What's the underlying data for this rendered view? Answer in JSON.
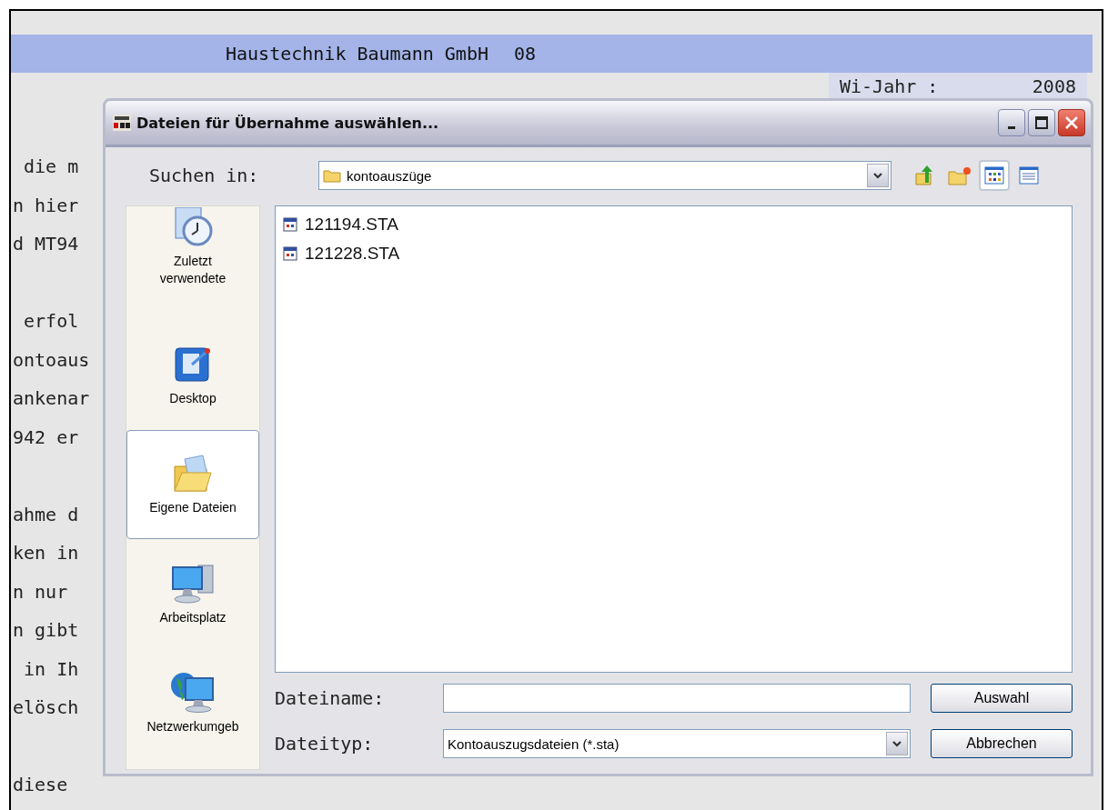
{
  "header": {
    "company": "Haustechnik Baumann GmbH",
    "number": "08",
    "fiscal_year_label": "Wi-Jahr :",
    "fiscal_year": "2008"
  },
  "background_paragraphs": [
    [
      " die m",
      "n hier",
      "d MT94"
    ],
    [
      " erfol",
      "ontoaus",
      "ankenar",
      "942 er"
    ],
    [
      "ahme d",
      "ken in",
      "n nur",
      "n gibt",
      " in Ih",
      "elösch"
    ],
    [
      "diese"
    ]
  ],
  "dialog": {
    "title": "Dateien für Übernahme auswählen...",
    "look_in_label": "Suchen in:",
    "look_in_value": "kontoauszüge",
    "toolbar": [
      {
        "kind": "up",
        "selected": false
      },
      {
        "kind": "newfolder",
        "selected": false
      },
      {
        "kind": "list",
        "selected": true
      },
      {
        "kind": "details",
        "selected": false
      }
    ],
    "places": [
      {
        "kind": "recent",
        "label": "Zuletzt verwendete",
        "selected": false
      },
      {
        "kind": "desktop",
        "label": "Desktop",
        "selected": false
      },
      {
        "kind": "documents",
        "label": "Eigene Dateien",
        "selected": true
      },
      {
        "kind": "computer",
        "label": "Arbeitsplatz",
        "selected": false
      },
      {
        "kind": "network",
        "label": "Netzwerkumgeb",
        "selected": false
      }
    ],
    "files": [
      "121194.STA",
      "121228.STA"
    ],
    "filename_label": "Dateiname:",
    "filetype_label": "Dateityp:",
    "filetype_value": "Kontoauszugsdateien (*.sta)",
    "buttons": [
      "Auswahl",
      "Abbrechen"
    ]
  }
}
